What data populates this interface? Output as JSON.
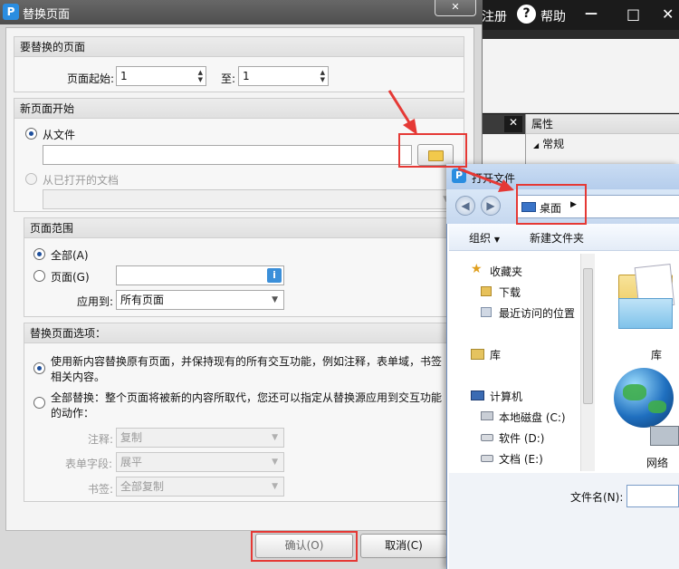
{
  "background_app": {
    "top_right": {
      "register": "注册",
      "help": "帮助",
      "help_glyph": "?",
      "minimize": "—",
      "maximize": "□",
      "close": "✕"
    },
    "panel_close": "✕",
    "properties_panel": {
      "title": "属性",
      "section": "常规"
    }
  },
  "replace_dialog": {
    "title": "替换页面",
    "title_close": "✕",
    "section_pages": {
      "title": "要替换的页面",
      "start_label": "页面起始:",
      "start_value": "1",
      "to_label": "至:",
      "to_value": "1"
    },
    "section_source": {
      "title": "新页面开始",
      "from_file": "从文件",
      "from_open_doc": "从已打开的文档",
      "file_path": ""
    },
    "section_range": {
      "title": "页面范围",
      "all": "全部(A)",
      "pages": "页面(G)",
      "pages_value": "",
      "apply_label": "应用到:",
      "apply_value": "所有页面"
    },
    "section_options": {
      "title": "替换页面选项：",
      "option1": "使用新内容替换原有页面，并保持现有的所有交互功能，例如注释，表单域，书签",
      "option1_cont": "相关内容。",
      "option2": "全部替换：整个页面将被新的内容所取代，您还可以指定从替换源应用到交互功能",
      "option2_cont": "的动作：",
      "annot_label": "注释:",
      "annot_value": "复制",
      "form_label": "表单字段:",
      "form_value": "展平",
      "bookmark_label": "书签:",
      "bookmark_value": "全部复制"
    },
    "ok": "确认(O)",
    "cancel": "取消(C)"
  },
  "open_file_dialog": {
    "title": "打开文件",
    "location": "桌面",
    "organize": "组织",
    "new_folder": "新建文件夹",
    "tree": [
      "收藏夹",
      "下载",
      "最近访问的位置",
      "库",
      "计算机",
      "本地磁盘 (C:)",
      "软件 (D:)",
      "文档 (E:)"
    ],
    "items": [
      "库",
      "网络"
    ],
    "filename_label": "文件名(N):",
    "filename_value": ""
  },
  "colors": {
    "highlight": "#e53935",
    "title_dark": "#4e4e4e",
    "radio_dot": "#1e4f9c"
  }
}
